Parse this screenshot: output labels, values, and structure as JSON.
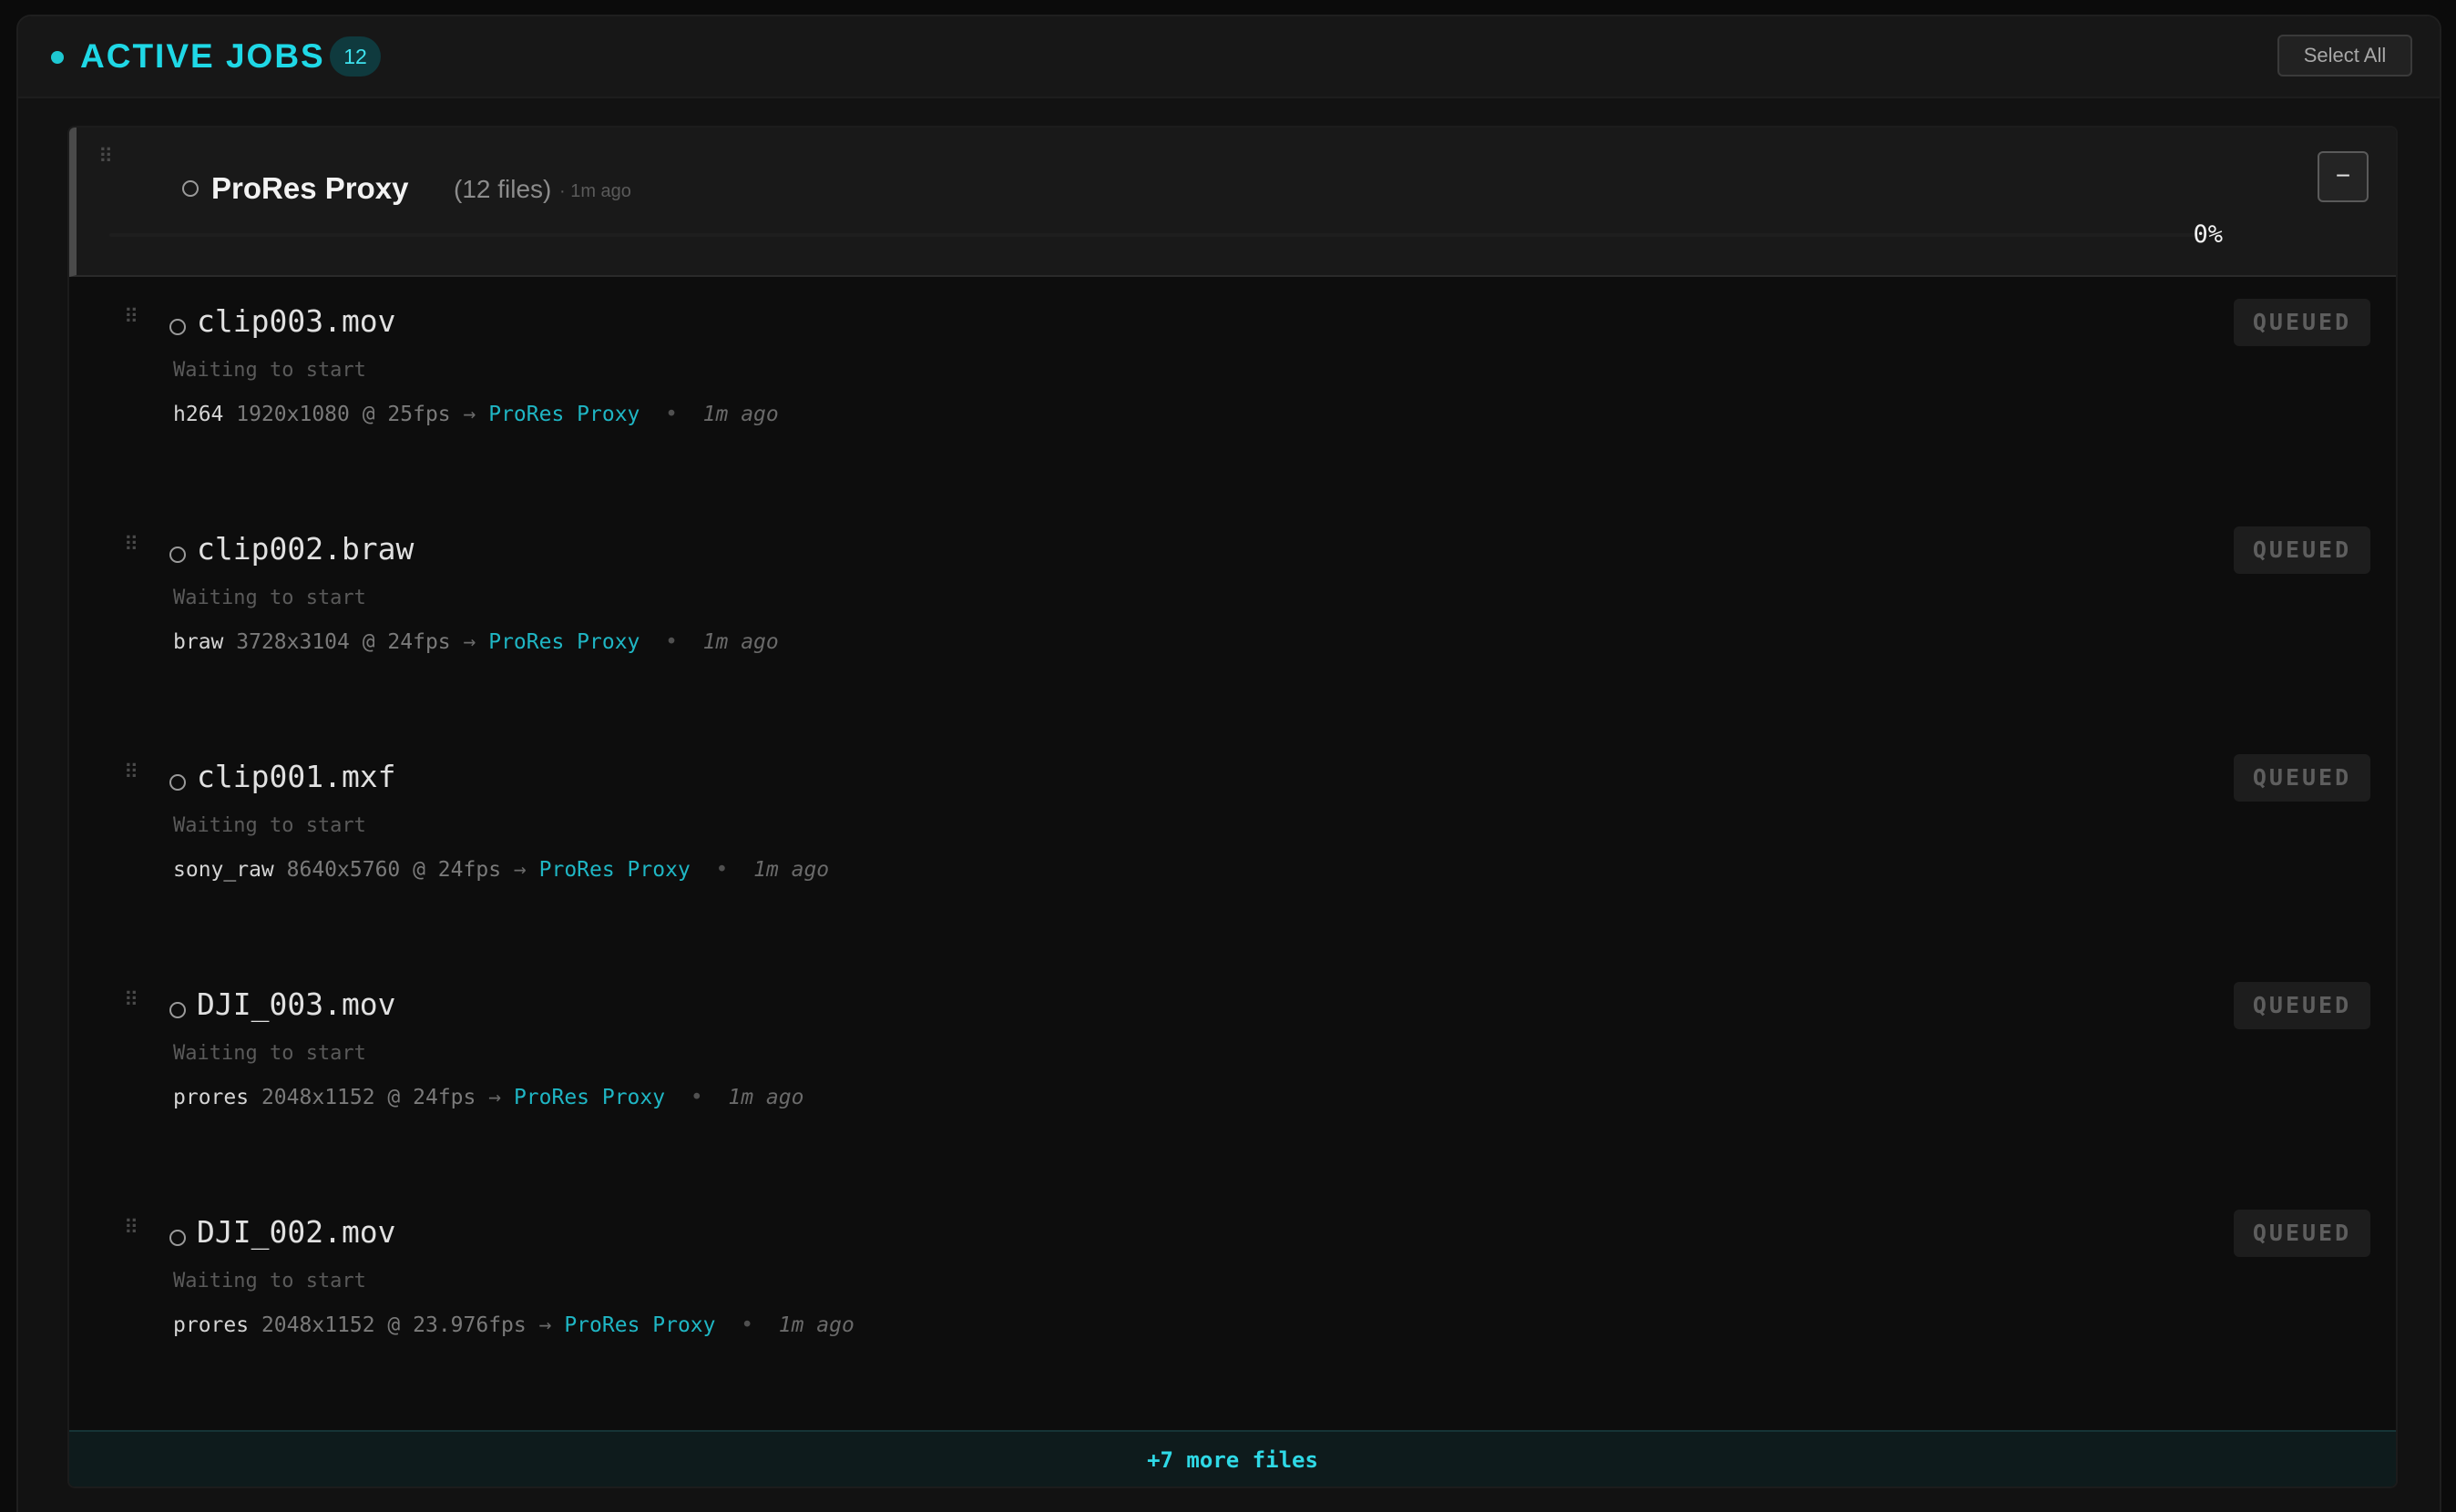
{
  "header": {
    "title": "ACTIVE JOBS",
    "count": "12",
    "select_all_label": "Select All"
  },
  "group": {
    "name": "ProRes Proxy",
    "file_count": "(12 files)",
    "ago": "· 1m ago",
    "collapse_label": "−",
    "progress_label": "0%",
    "progress_fraction": 0
  },
  "files": [
    {
      "name": "clip003.mov",
      "status_text": "Waiting to start",
      "codec": "h264",
      "spec": "1920x1080 @ 25fps",
      "arrow": "→",
      "target": "ProRes Proxy",
      "sep": "•",
      "ago": "1m ago",
      "badge": "QUEUED"
    },
    {
      "name": "clip002.braw",
      "status_text": "Waiting to start",
      "codec": "braw",
      "spec": "3728x3104 @ 24fps",
      "arrow": "→",
      "target": "ProRes Proxy",
      "sep": "•",
      "ago": "1m ago",
      "badge": "QUEUED"
    },
    {
      "name": "clip001.mxf",
      "status_text": "Waiting to start",
      "codec": "sony_raw",
      "spec": "8640x5760 @ 24fps",
      "arrow": "→",
      "target": "ProRes Proxy",
      "sep": "•",
      "ago": "1m ago",
      "badge": "QUEUED"
    },
    {
      "name": "DJI_003.mov",
      "status_text": "Waiting to start",
      "codec": "prores",
      "spec": "2048x1152 @ 24fps",
      "arrow": "→",
      "target": "ProRes Proxy",
      "sep": "•",
      "ago": "1m ago",
      "badge": "QUEUED"
    },
    {
      "name": "DJI_002.mov",
      "status_text": "Waiting to start",
      "codec": "prores",
      "spec": "2048x1152 @ 23.976fps",
      "arrow": "→",
      "target": "ProRes Proxy",
      "sep": "•",
      "ago": "1m ago",
      "badge": "QUEUED"
    }
  ],
  "more_files_label": "+7 more files",
  "colors": {
    "accent": "#1ec8d2",
    "target": "#1fb6c4",
    "background": "#0b0b0b"
  }
}
